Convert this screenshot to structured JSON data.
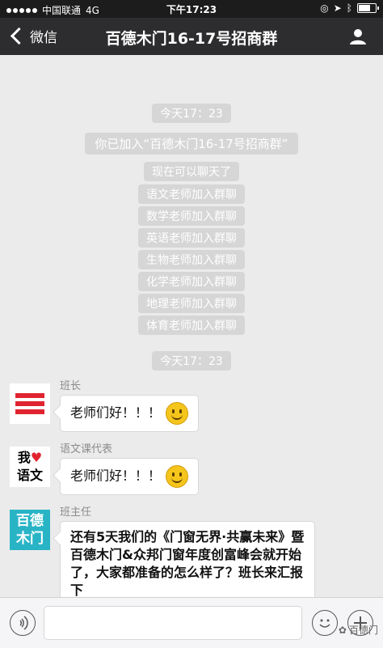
{
  "status_bar": {
    "carrier": "中国联通",
    "network": "4G",
    "time": "下午17:23"
  },
  "nav": {
    "back_label": "微信",
    "title": "百德木门16-17号招商群"
  },
  "chat": {
    "timestamps": [
      "今天17：23",
      "今天17：23"
    ],
    "join_notice": "你已加入“百德木门16-17号招商群”",
    "system_messages": [
      "现在可以聊天了",
      "语文老师加入群聊",
      "数学老师加入群聊",
      "英语老师加入群聊",
      "生物老师加入群聊",
      "化学老师加入群聊",
      "地理老师加入群聊",
      "体育老师加入群聊"
    ],
    "messages": [
      {
        "nick": "班长",
        "text": "老师们好！！！",
        "avatar": "red-stripes-avatar"
      },
      {
        "nick": "语文课代表",
        "text": "老师们好！！！",
        "avatar": "chinese-heart-avatar",
        "avatar_text_top": "我",
        "avatar_text_bottom": "语文"
      },
      {
        "nick": "班主任",
        "text": "还有5天我们的《门窗无界·共赢未来》暨百德木门&众邦门窗年度创富峰会就开始了，大家都准备的怎么样了？班长来汇报下",
        "avatar": "baide-logo-avatar",
        "avatar_text_top": "百德",
        "avatar_text_bottom": "木门"
      }
    ]
  },
  "watermark": "百德门",
  "colors": {
    "nav_bg": "#2d2d2f",
    "chat_bg": "#ebebeb",
    "system_pill": "#d6d6d6",
    "logo_teal": "#29b4c6",
    "heart_red": "#e0242f"
  }
}
